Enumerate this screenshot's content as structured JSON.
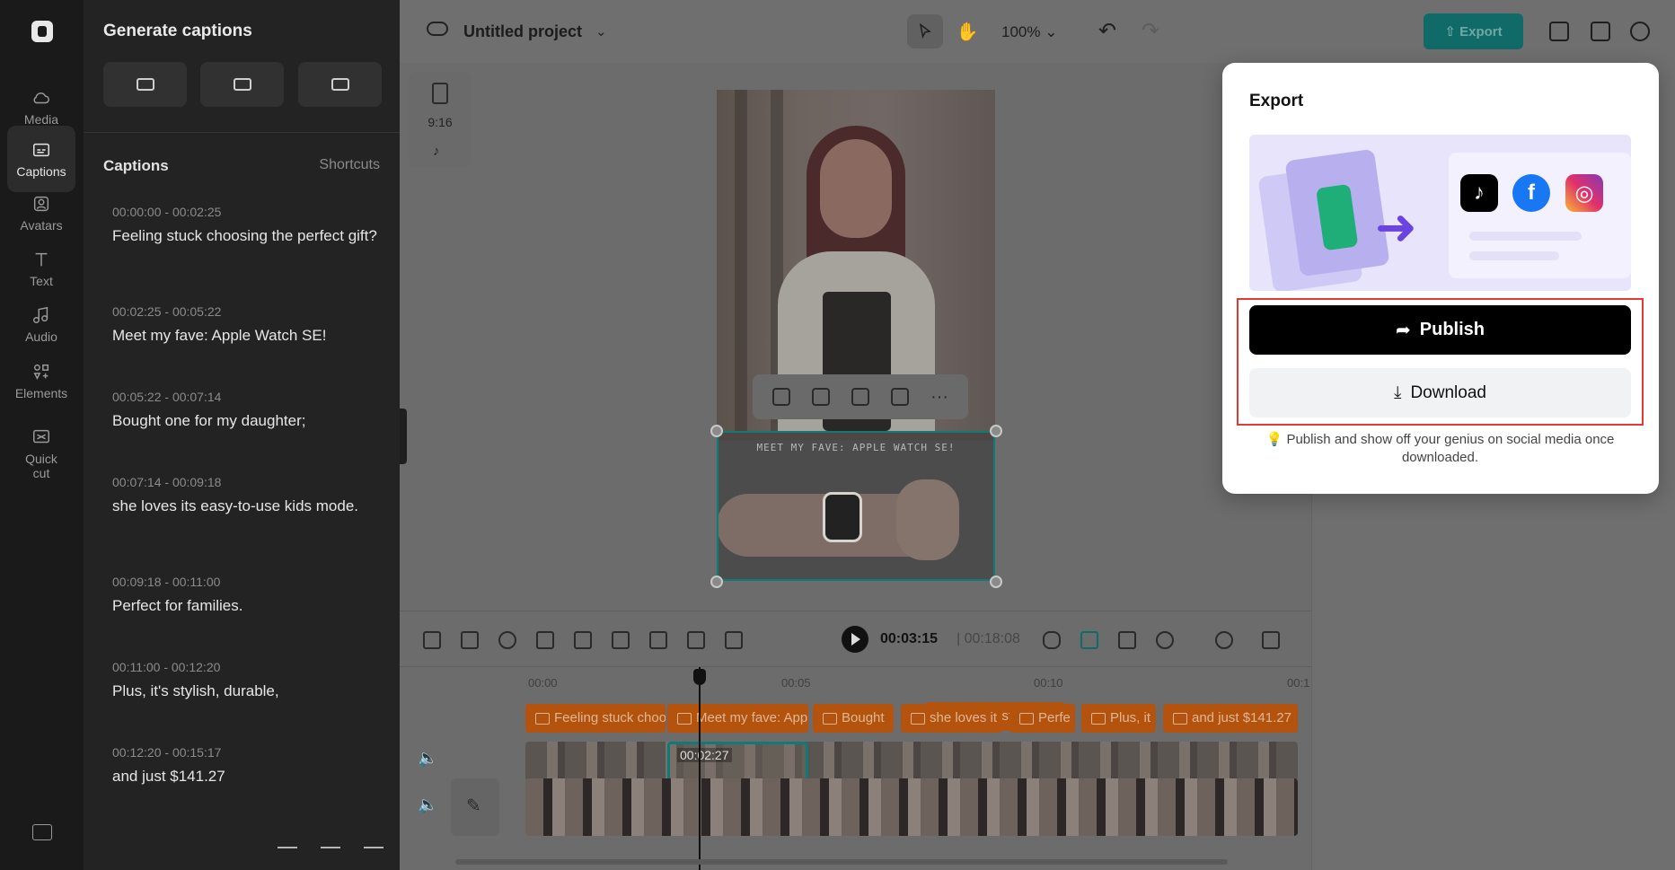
{
  "rail": {
    "items": [
      {
        "label": "Media",
        "icon": "cloud-icon"
      },
      {
        "label": "Captions",
        "icon": "captions-icon",
        "active": true
      },
      {
        "label": "Avatars",
        "icon": "avatar-icon"
      },
      {
        "label": "Text",
        "icon": "text-icon"
      },
      {
        "label": "Audio",
        "icon": "music-icon"
      },
      {
        "label": "Elements",
        "icon": "elements-icon"
      },
      {
        "label": "Quick cut",
        "icon": "quick-cut-icon"
      }
    ]
  },
  "panel": {
    "title": "Generate captions",
    "captions_header": "Captions",
    "shortcuts": "Shortcuts",
    "captions": [
      {
        "time": "00:00:00 - 00:02:25",
        "text": "Feeling stuck choosing the perfect gift?"
      },
      {
        "time": "00:02:25 - 00:05:22",
        "text": "Meet my fave: Apple Watch SE!"
      },
      {
        "time": "00:05:22 - 00:07:14",
        "text": "Bought one for my daughter;"
      },
      {
        "time": "00:07:14 - 00:09:18",
        "text": "she loves its easy-to-use kids mode."
      },
      {
        "time": "00:09:18 - 00:11:00",
        "text": "Perfect for families."
      },
      {
        "time": "00:11:00 - 00:12:20",
        "text": "Plus, it's stylish, durable,"
      },
      {
        "time": "00:12:20 - 00:15:17",
        "text": "and just $141.27"
      }
    ]
  },
  "topbar": {
    "project_name": "Untitled project",
    "zoom": "100%",
    "export_label": "Export"
  },
  "canvas": {
    "ratio_label": "9:16",
    "caption_overlay": "MEET MY FAVE: APPLE WATCH SE!"
  },
  "modal": {
    "title": "Export",
    "publish_label": "Publish",
    "download_label": "Download",
    "tip": "Publish and show off your genius on social media once downloaded."
  },
  "timeline": {
    "current_time": "00:03:15",
    "total_time": "00:18:08",
    "ticks": [
      "00:00",
      "00:05",
      "00:10",
      "00:1"
    ],
    "selected_clip_time": "00:02:27",
    "caption_clips": [
      "Feeling stuck choosing the perfect gift?",
      "Meet my fave: Apple Watch SE!",
      "Bought",
      "she loves it",
      "Perfe",
      "Plus, it",
      "and just $141.27"
    ]
  }
}
